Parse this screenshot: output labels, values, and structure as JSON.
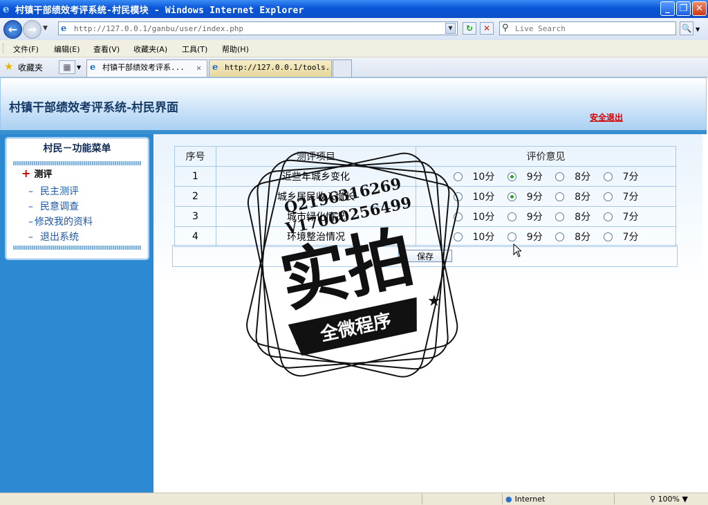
{
  "window": {
    "title": "村镇干部绩效考评系统-村民模块 - Windows Internet Explorer",
    "controls": [
      "_",
      "❐",
      "✕"
    ]
  },
  "addressbar": {
    "url": "http://127.0.0.1/ganbu/user/index.php",
    "search_placeholder": "Live Search"
  },
  "menubar": {
    "items": [
      "文件(F)",
      "编辑(E)",
      "查看(V)",
      "收藏夹(A)",
      "工具(T)",
      "帮助(H)"
    ]
  },
  "tabbar": {
    "favorites_label": "收藏夹",
    "tabs": [
      {
        "label": "村镇干部绩效考评系..."
      },
      {
        "label": "http://127.0.0.1/tools..."
      }
    ]
  },
  "page": {
    "header_title": "村镇干部绩效考评系统-村民界面",
    "logout_label": "安全退出"
  },
  "sidebar": {
    "menu_title": "村民－功能菜单",
    "category": "测评",
    "items": [
      "民主测评",
      "民意调查",
      "修改我的资料",
      "退出系统"
    ]
  },
  "table": {
    "headers": [
      "序号",
      "测评项目",
      "评价意见"
    ],
    "options": [
      "10分",
      "9分",
      "8分",
      "7分"
    ],
    "rows": [
      {
        "no": "1",
        "item": "近些年城乡变化",
        "selected": "9分"
      },
      {
        "no": "2",
        "item": "城乡居民收入增长",
        "selected": "9分"
      },
      {
        "no": "3",
        "item": "城市绿化情况",
        "selected": null
      },
      {
        "no": "4",
        "item": "环境整治情况",
        "selected": null
      }
    ],
    "save_label": "保存"
  },
  "watermark": {
    "line1": "Q2196316269",
    "line2": "V17060256499",
    "main": "实拍",
    "banner": "全微程序"
  },
  "statusbar": {
    "zone": "Internet",
    "zoom": "100%"
  },
  "colors": {
    "sidebar_blue": "#2d8ad2",
    "logout_red": "#d10000",
    "header_text": "#153a66",
    "radio_selected": "#2ea02e"
  }
}
